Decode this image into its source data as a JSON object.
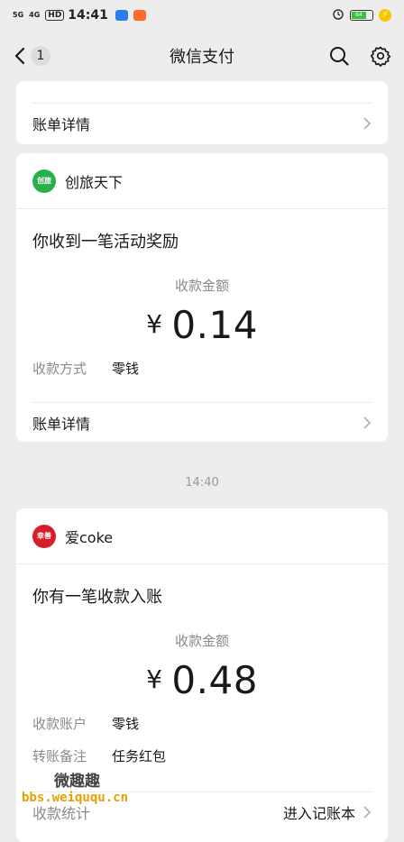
{
  "status_bar": {
    "signal1": "5G",
    "signal2": "4G",
    "hd": "HD",
    "time": "14:41",
    "battery_level": "64",
    "app_icon_colors": [
      "#2b7de9",
      "#ff6a2a"
    ]
  },
  "nav": {
    "title": "微信支付",
    "unread_count": "1",
    "icons": [
      "back-chevron-icon",
      "search-icon",
      "settings-gear-icon"
    ]
  },
  "top_card": {
    "link_label": "账单详情"
  },
  "card1": {
    "merchant": "创旅天下",
    "logo_color": "#2ab04a",
    "logo_text": "创旅",
    "headline": "你收到一笔活动奖励",
    "amount_label": "收款金额",
    "currency": "¥",
    "amount": "0.14",
    "fields": [
      {
        "key": "收款方式",
        "value": "零钱"
      }
    ],
    "link_label": "账单详情"
  },
  "time_separator": "14:40",
  "card2": {
    "merchant": "爱coke",
    "logo_color": "#d81e2c",
    "logo_text": "幸善",
    "headline": "你有一笔收款入账",
    "amount_label": "收款金额",
    "currency": "¥",
    "amount": "0.48",
    "fields": [
      {
        "key": "收款账户",
        "value": "零钱"
      },
      {
        "key": "转账备注",
        "value": "任务红包"
      }
    ],
    "footer_left": "收款统计",
    "footer_right": "进入记账本"
  },
  "watermark": {
    "line1": "微趣趣",
    "line2": "bbs.weiququ.cn"
  }
}
